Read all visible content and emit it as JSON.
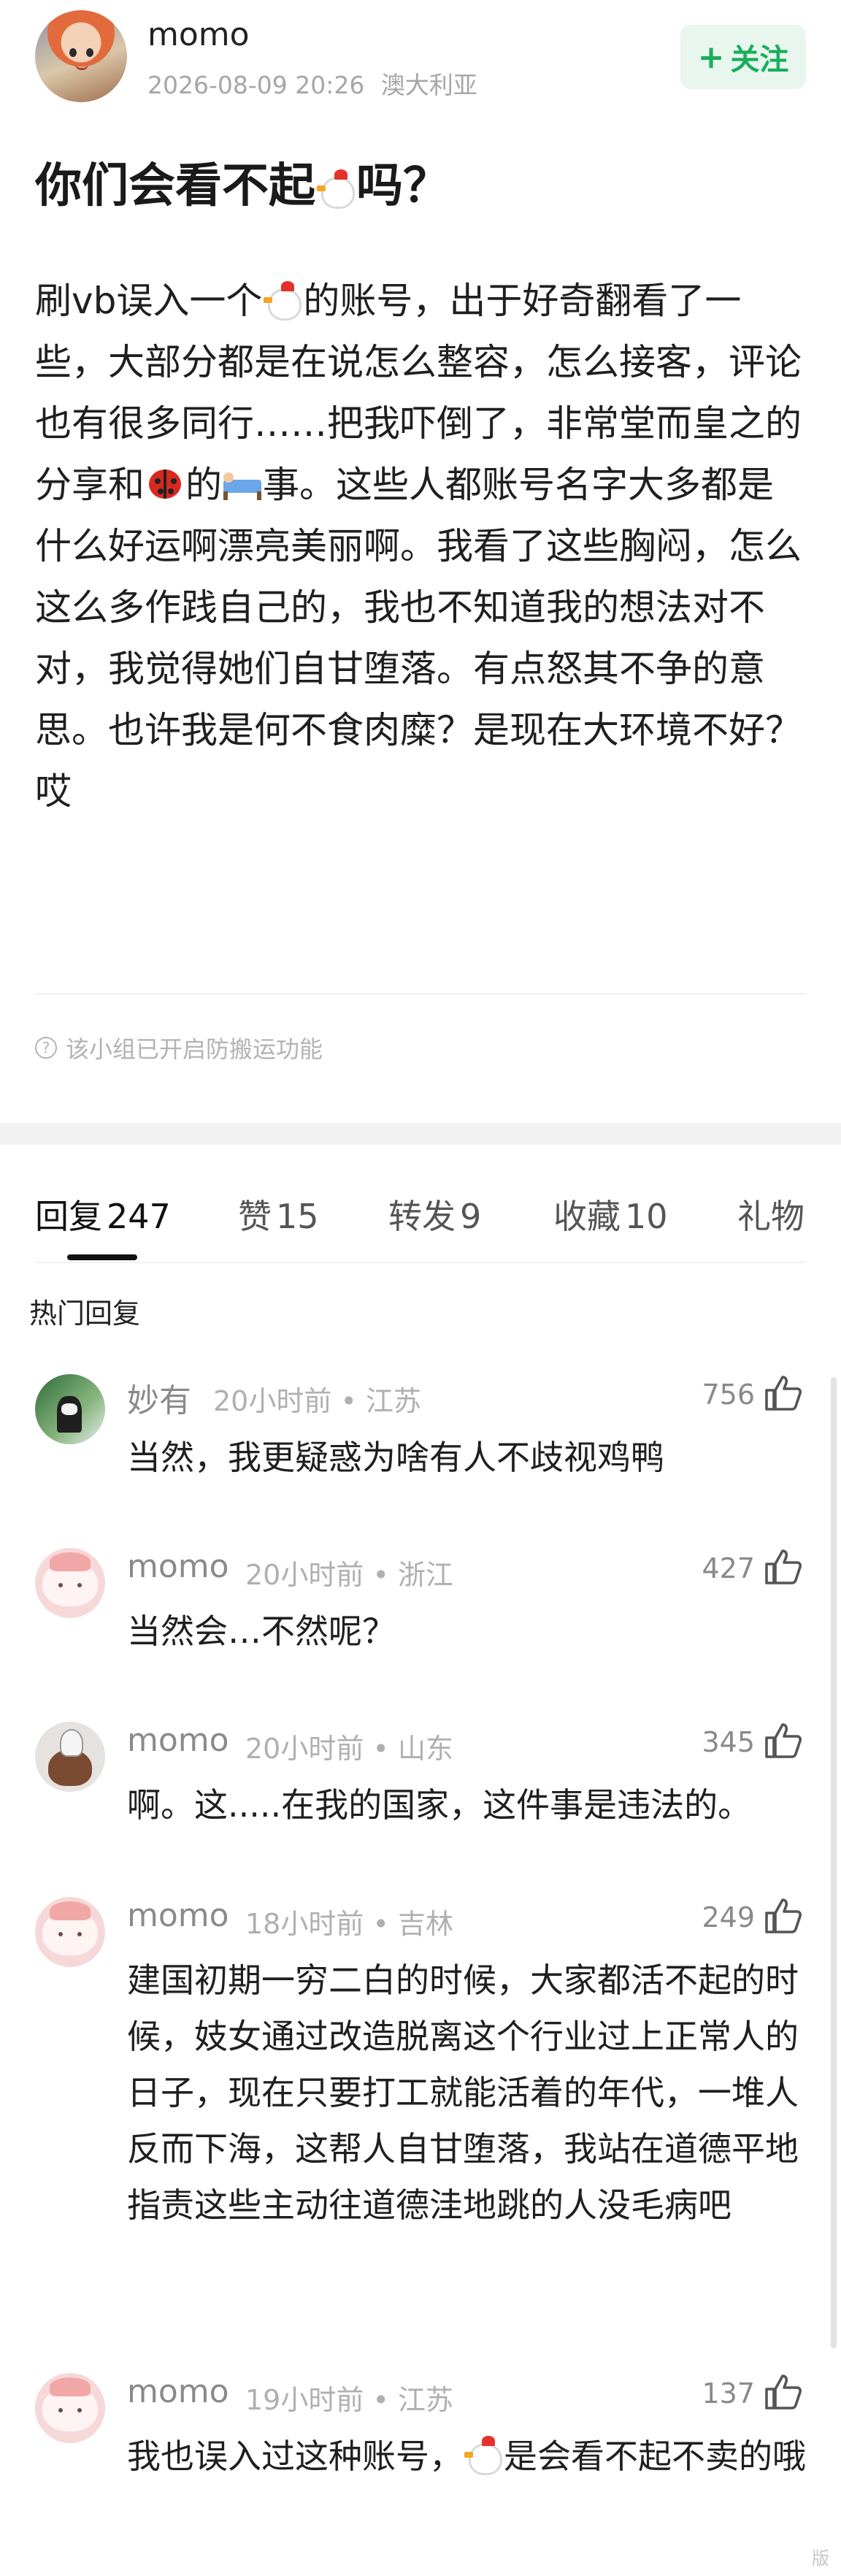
{
  "post": {
    "author": {
      "name": "momo",
      "avatar": "anime-avatar"
    },
    "meta": {
      "datetime": "2026-08-09 20:26",
      "location": "澳大利亚"
    },
    "follow_label": "关注",
    "title_before": "你们会看不起",
    "title_emoji": "chicken-emoji",
    "title_after": "吗？",
    "body": {
      "p1": "刷vb误入一个",
      "p2": "的账号，出于好奇翻看了一些，大部分都是在说怎么整容，怎么接客，评论也有很多同行……把我吓倒了，非常堂而皇之的分享和",
      "p3": "的",
      "p4": "事。这些人都账号名字大多都是什么好运啊漂亮美丽啊。我看了这些胸闷，怎么这么多作践自己的，我也不知道我的想法对不对，我觉得她们自甘堕落。有点怒其不争的意思。也许我是何不食肉糜？是现在大环境不好？哎"
    },
    "notice": "该小组已开启防搬运功能"
  },
  "tabs": [
    {
      "label": "回复",
      "count": "247",
      "active": true
    },
    {
      "label": "赞",
      "count": "15"
    },
    {
      "label": "转发",
      "count": "9"
    },
    {
      "label": "收藏",
      "count": "10"
    },
    {
      "label": "礼物",
      "count": ""
    }
  ],
  "hot_replies_title": "热门回复",
  "comments": [
    {
      "name": "妙有",
      "time": "20小时前",
      "location": "江苏",
      "likes": "756",
      "avatar": "green-avatar",
      "text": "当然，我更疑惑为啥有人不歧视鸡鸭"
    },
    {
      "name": "momo",
      "time": "20小时前",
      "location": "浙江",
      "likes": "427",
      "avatar": "pink-blob-avatar",
      "text": "当然会…不然呢？"
    },
    {
      "name": "momo",
      "time": "20小时前",
      "location": "山东",
      "likes": "345",
      "avatar": "gray-avatar",
      "text": "啊。这.....在我的国家，这件事是违法的。"
    },
    {
      "name": "momo",
      "time": "18小时前",
      "location": "吉林",
      "likes": "249",
      "avatar": "pink-blob-avatar",
      "text": "建国初期一穷二白的时候，大家都活不起的时候，妓女通过改造脱离这个行业过上正常人的日子，现在只要打工就能活着的年代，一堆人反而下海，这帮人自甘堕落，我站在道德平地指责这些主动往道德洼地跳的人没毛病吧"
    },
    {
      "name": "momo",
      "time": "19小时前",
      "location": "江苏",
      "likes": "137",
      "avatar": "pink-blob-avatar",
      "text_before": "我也误入过这种账号，",
      "text_after": "是会看不起不卖的哦"
    }
  ],
  "separator": "•",
  "watermark": "版"
}
